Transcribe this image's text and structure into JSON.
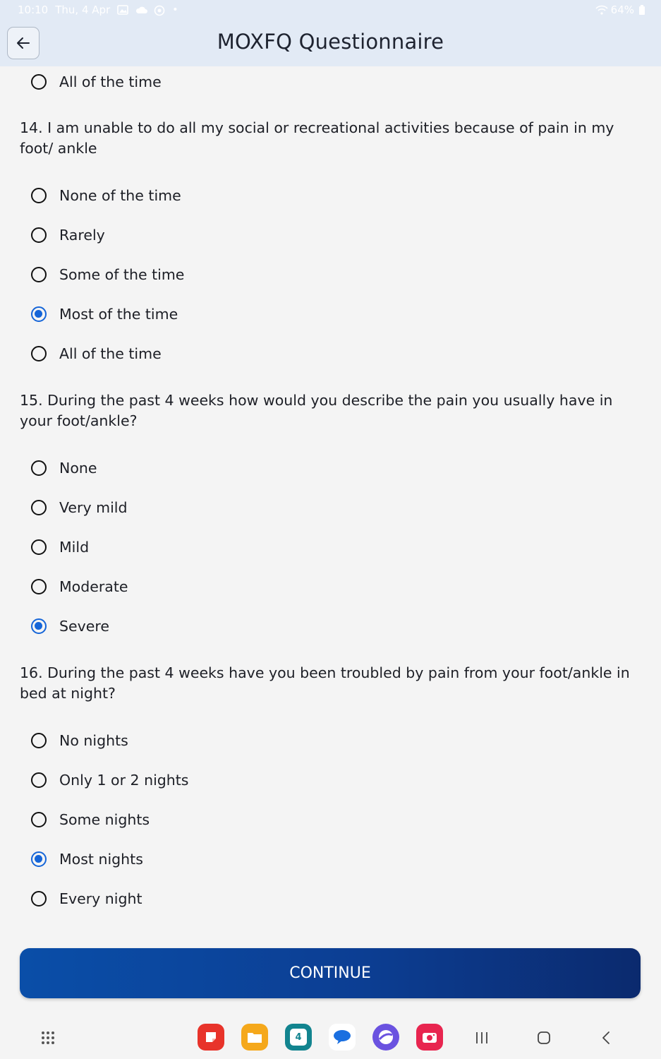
{
  "status_bar": {
    "time": "10:10",
    "date": "Thu, 4 Apr",
    "battery": "64%"
  },
  "header": {
    "title": "MOXFQ Questionnaire"
  },
  "q13_tail": {
    "options": [
      {
        "label": "All of the time",
        "checked": false
      }
    ]
  },
  "q14": {
    "text": "14. I am unable to do all my social or recreational activities because of pain in my foot/ ankle",
    "options": [
      {
        "label": "None of the time",
        "checked": false
      },
      {
        "label": "Rarely",
        "checked": false
      },
      {
        "label": "Some of the time",
        "checked": false
      },
      {
        "label": "Most of the time",
        "checked": true
      },
      {
        "label": "All of the time",
        "checked": false
      }
    ]
  },
  "q15": {
    "text": "15. During the past 4 weeks how would you describe the pain you usually have in your foot/ankle?",
    "options": [
      {
        "label": "None",
        "checked": false
      },
      {
        "label": "Very mild",
        "checked": false
      },
      {
        "label": "Mild",
        "checked": false
      },
      {
        "label": "Moderate",
        "checked": false
      },
      {
        "label": "Severe",
        "checked": true
      }
    ]
  },
  "q16": {
    "text": "16. During the past 4 weeks have you been troubled by pain from your foot/ankle in bed at night?",
    "options": [
      {
        "label": "No nights",
        "checked": false
      },
      {
        "label": "Only 1 or 2 nights",
        "checked": false
      },
      {
        "label": "Some nights",
        "checked": false
      },
      {
        "label": "Most nights",
        "checked": true
      },
      {
        "label": "Every night",
        "checked": false
      }
    ]
  },
  "continue_label": "CONTINUE",
  "dock": {
    "calendar_day": "4",
    "colors": {
      "accent": "#1565d8",
      "button_start": "#0a4ea8",
      "button_end": "#0b2a6e"
    },
    "apps": [
      "notes-app-icon",
      "files-app-icon",
      "calendar-app-icon",
      "messages-app-icon",
      "internet-app-icon",
      "camera-app-icon"
    ]
  }
}
